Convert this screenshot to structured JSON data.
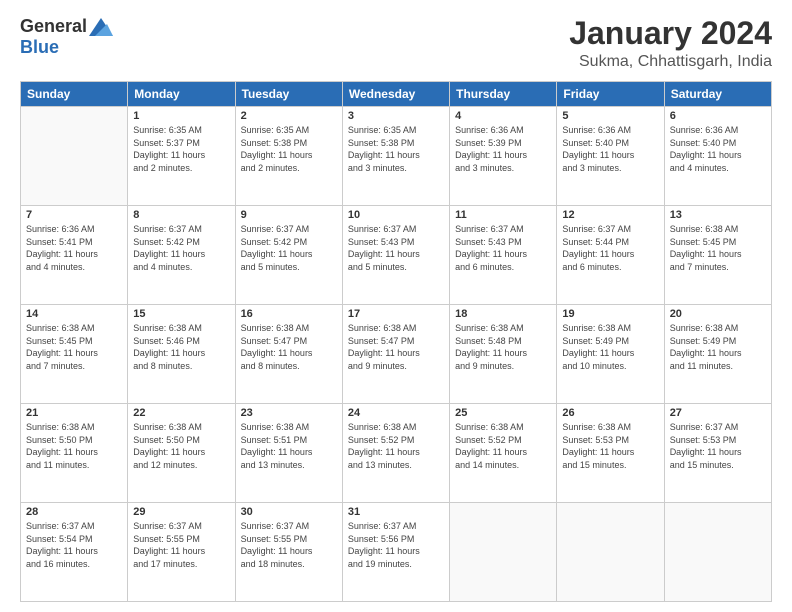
{
  "header": {
    "logo": {
      "general": "General",
      "blue": "Blue"
    },
    "title": "January 2024",
    "location": "Sukma, Chhattisgarh, India"
  },
  "days_of_week": [
    "Sunday",
    "Monday",
    "Tuesday",
    "Wednesday",
    "Thursday",
    "Friday",
    "Saturday"
  ],
  "weeks": [
    [
      {
        "day": "",
        "info": ""
      },
      {
        "day": "1",
        "info": "Sunrise: 6:35 AM\nSunset: 5:37 PM\nDaylight: 11 hours\nand 2 minutes."
      },
      {
        "day": "2",
        "info": "Sunrise: 6:35 AM\nSunset: 5:38 PM\nDaylight: 11 hours\nand 2 minutes."
      },
      {
        "day": "3",
        "info": "Sunrise: 6:35 AM\nSunset: 5:38 PM\nDaylight: 11 hours\nand 3 minutes."
      },
      {
        "day": "4",
        "info": "Sunrise: 6:36 AM\nSunset: 5:39 PM\nDaylight: 11 hours\nand 3 minutes."
      },
      {
        "day": "5",
        "info": "Sunrise: 6:36 AM\nSunset: 5:40 PM\nDaylight: 11 hours\nand 3 minutes."
      },
      {
        "day": "6",
        "info": "Sunrise: 6:36 AM\nSunset: 5:40 PM\nDaylight: 11 hours\nand 4 minutes."
      }
    ],
    [
      {
        "day": "7",
        "info": "Sunrise: 6:36 AM\nSunset: 5:41 PM\nDaylight: 11 hours\nand 4 minutes."
      },
      {
        "day": "8",
        "info": "Sunrise: 6:37 AM\nSunset: 5:42 PM\nDaylight: 11 hours\nand 4 minutes."
      },
      {
        "day": "9",
        "info": "Sunrise: 6:37 AM\nSunset: 5:42 PM\nDaylight: 11 hours\nand 5 minutes."
      },
      {
        "day": "10",
        "info": "Sunrise: 6:37 AM\nSunset: 5:43 PM\nDaylight: 11 hours\nand 5 minutes."
      },
      {
        "day": "11",
        "info": "Sunrise: 6:37 AM\nSunset: 5:43 PM\nDaylight: 11 hours\nand 6 minutes."
      },
      {
        "day": "12",
        "info": "Sunrise: 6:37 AM\nSunset: 5:44 PM\nDaylight: 11 hours\nand 6 minutes."
      },
      {
        "day": "13",
        "info": "Sunrise: 6:38 AM\nSunset: 5:45 PM\nDaylight: 11 hours\nand 7 minutes."
      }
    ],
    [
      {
        "day": "14",
        "info": "Sunrise: 6:38 AM\nSunset: 5:45 PM\nDaylight: 11 hours\nand 7 minutes."
      },
      {
        "day": "15",
        "info": "Sunrise: 6:38 AM\nSunset: 5:46 PM\nDaylight: 11 hours\nand 8 minutes."
      },
      {
        "day": "16",
        "info": "Sunrise: 6:38 AM\nSunset: 5:47 PM\nDaylight: 11 hours\nand 8 minutes."
      },
      {
        "day": "17",
        "info": "Sunrise: 6:38 AM\nSunset: 5:47 PM\nDaylight: 11 hours\nand 9 minutes."
      },
      {
        "day": "18",
        "info": "Sunrise: 6:38 AM\nSunset: 5:48 PM\nDaylight: 11 hours\nand 9 minutes."
      },
      {
        "day": "19",
        "info": "Sunrise: 6:38 AM\nSunset: 5:49 PM\nDaylight: 11 hours\nand 10 minutes."
      },
      {
        "day": "20",
        "info": "Sunrise: 6:38 AM\nSunset: 5:49 PM\nDaylight: 11 hours\nand 11 minutes."
      }
    ],
    [
      {
        "day": "21",
        "info": "Sunrise: 6:38 AM\nSunset: 5:50 PM\nDaylight: 11 hours\nand 11 minutes."
      },
      {
        "day": "22",
        "info": "Sunrise: 6:38 AM\nSunset: 5:50 PM\nDaylight: 11 hours\nand 12 minutes."
      },
      {
        "day": "23",
        "info": "Sunrise: 6:38 AM\nSunset: 5:51 PM\nDaylight: 11 hours\nand 13 minutes."
      },
      {
        "day": "24",
        "info": "Sunrise: 6:38 AM\nSunset: 5:52 PM\nDaylight: 11 hours\nand 13 minutes."
      },
      {
        "day": "25",
        "info": "Sunrise: 6:38 AM\nSunset: 5:52 PM\nDaylight: 11 hours\nand 14 minutes."
      },
      {
        "day": "26",
        "info": "Sunrise: 6:38 AM\nSunset: 5:53 PM\nDaylight: 11 hours\nand 15 minutes."
      },
      {
        "day": "27",
        "info": "Sunrise: 6:37 AM\nSunset: 5:53 PM\nDaylight: 11 hours\nand 15 minutes."
      }
    ],
    [
      {
        "day": "28",
        "info": "Sunrise: 6:37 AM\nSunset: 5:54 PM\nDaylight: 11 hours\nand 16 minutes."
      },
      {
        "day": "29",
        "info": "Sunrise: 6:37 AM\nSunset: 5:55 PM\nDaylight: 11 hours\nand 17 minutes."
      },
      {
        "day": "30",
        "info": "Sunrise: 6:37 AM\nSunset: 5:55 PM\nDaylight: 11 hours\nand 18 minutes."
      },
      {
        "day": "31",
        "info": "Sunrise: 6:37 AM\nSunset: 5:56 PM\nDaylight: 11 hours\nand 19 minutes."
      },
      {
        "day": "",
        "info": ""
      },
      {
        "day": "",
        "info": ""
      },
      {
        "day": "",
        "info": ""
      }
    ]
  ]
}
